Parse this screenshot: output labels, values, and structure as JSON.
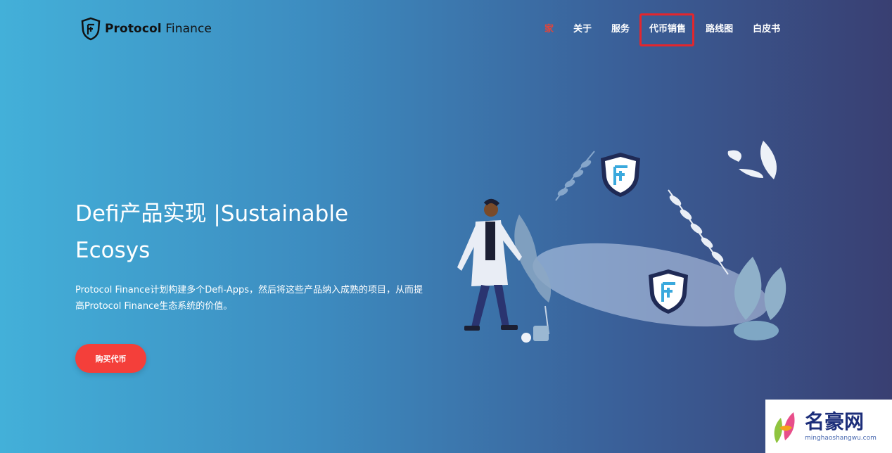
{
  "header": {
    "logo_bold": "Protocol",
    "logo_rest": "Finance",
    "nav": [
      {
        "label": "家",
        "active": true
      },
      {
        "label": "关于"
      },
      {
        "label": "服务"
      },
      {
        "label": "代币销售"
      },
      {
        "label": "路线图"
      },
      {
        "label": "白皮书"
      }
    ]
  },
  "hero": {
    "title": "Defi产品实现 |Sustainable Ecosys",
    "description": "Protocol Finance计划构建多个Defi-Apps，然后将这些产品纳入成熟的项目，从而提高Protocol Finance生态系统的价值。",
    "cta_label": "购买代币"
  },
  "watermark": {
    "name": "名豪网",
    "url": "minghaoshangwu.com"
  },
  "colors": {
    "accent": "#f43f3a",
    "active_nav": "#e2453b",
    "highlight": "#e3262d"
  }
}
